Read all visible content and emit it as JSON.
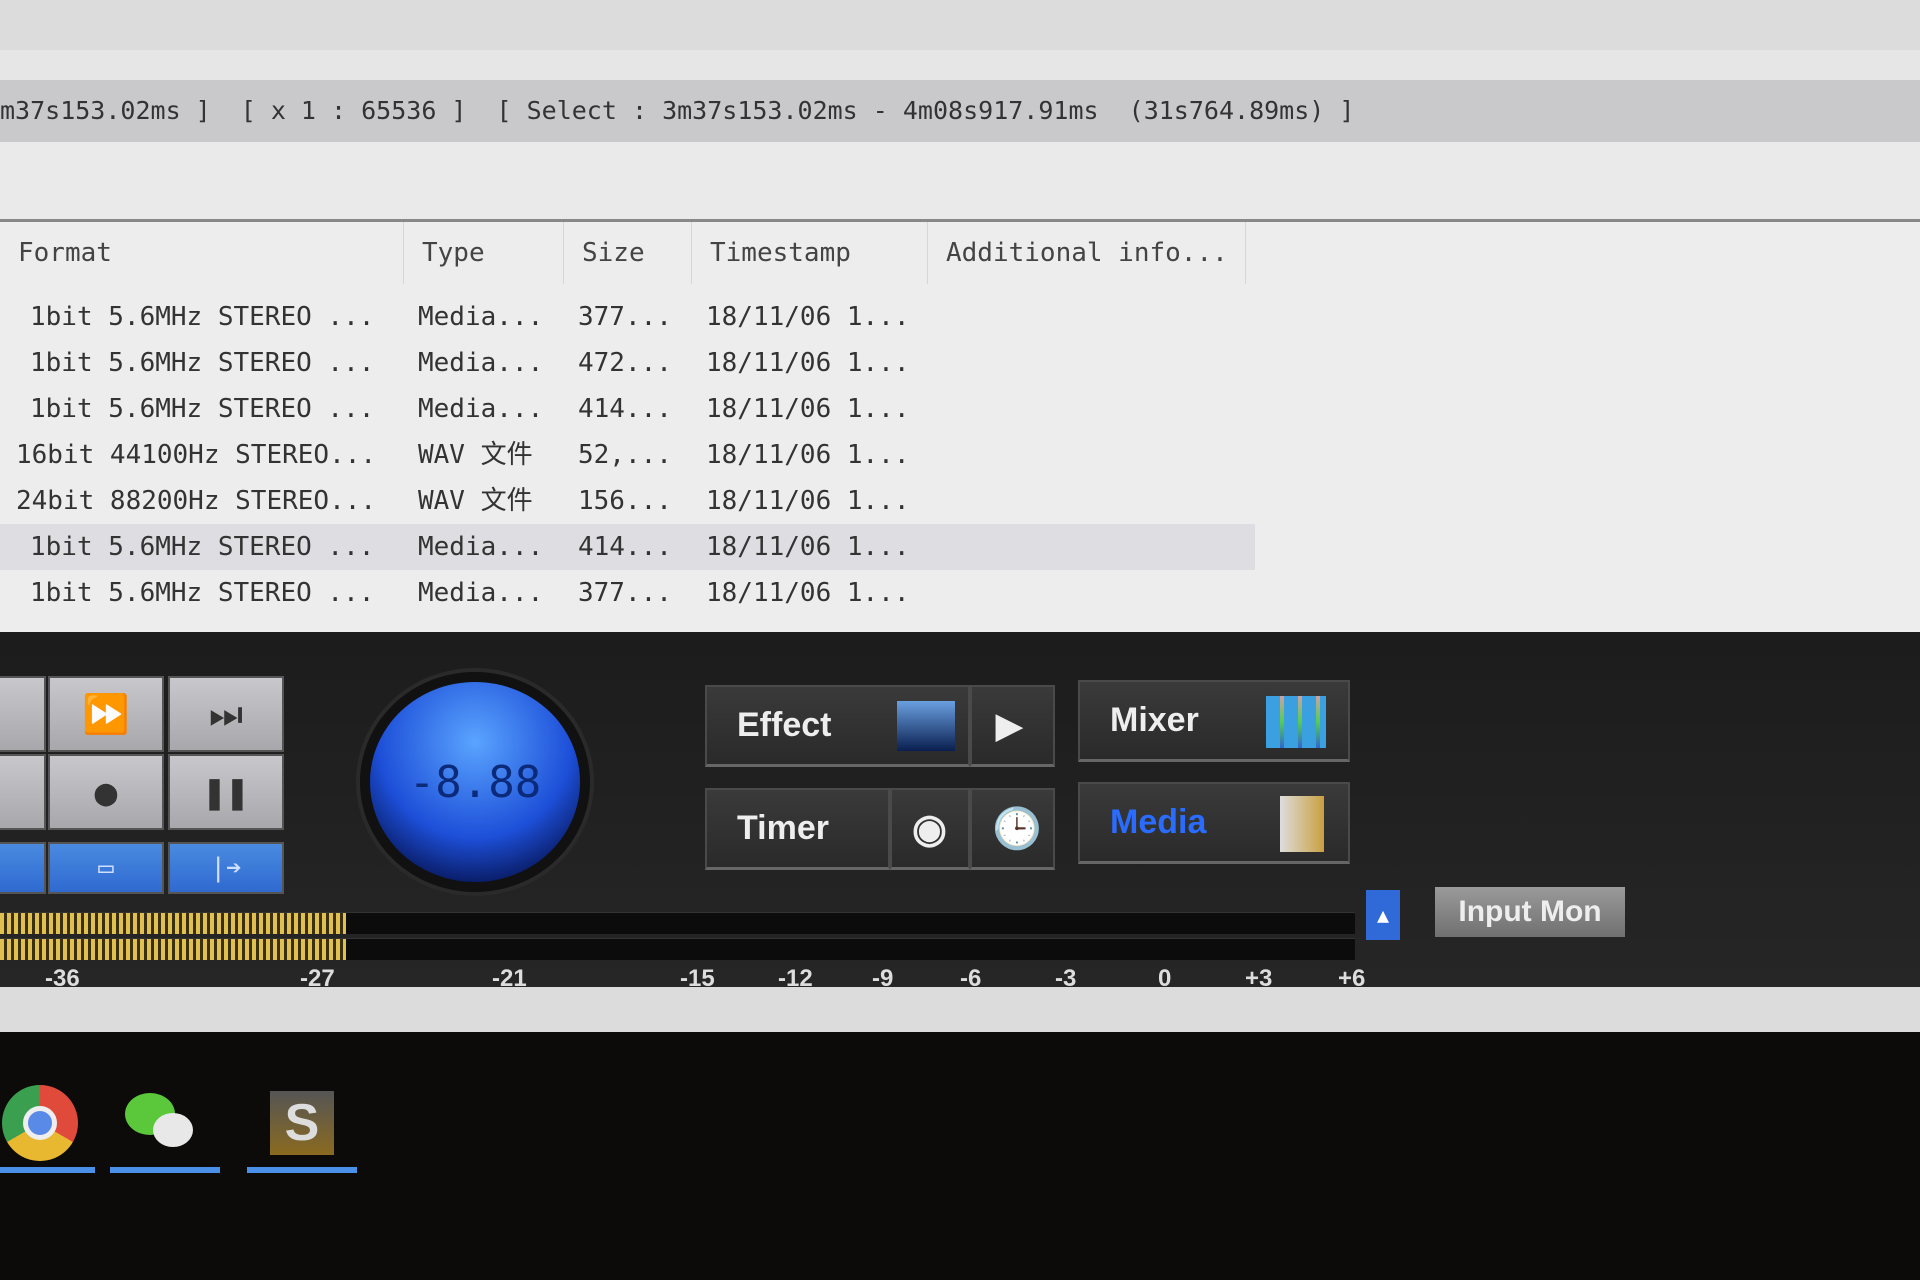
{
  "status_bar": {
    "position": "m37s153.02ms ]",
    "zoom": "[ x 1 : 65536 ]",
    "select": "[ Select : 3m37s153.02ms - 4m08s917.91ms  (31s764.89ms) ]"
  },
  "table": {
    "columns": [
      "Format",
      "Type",
      "Size",
      "Timestamp",
      "Additional info..."
    ],
    "rows": [
      [
        "1bit 5.6MHz STEREO ...",
        "Media...",
        "377...",
        "18/11/06 1..."
      ],
      [
        "1bit 5.6MHz STEREO ...",
        "Media...",
        "472...",
        "18/11/06 1..."
      ],
      [
        "1bit 5.6MHz STEREO ...",
        "Media...",
        "414...",
        "18/11/06 1..."
      ],
      [
        "16bit 44100Hz STEREO...",
        "WAV 文件",
        "52,...",
        "18/11/06 1..."
      ],
      [
        "24bit 88200Hz STEREO...",
        "WAV 文件",
        "156...",
        "18/11/06 1..."
      ],
      [
        "1bit 5.6MHz STEREO ...",
        "Media...",
        "414...",
        "18/11/06 1..."
      ],
      [
        "1bit 5.6MHz STEREO ...",
        "Media...",
        "377...",
        "18/11/06 1..."
      ]
    ],
    "selected_row": 5
  },
  "dial": {
    "value": "-8.88"
  },
  "buttons": {
    "effect": "Effect",
    "mixer": "Mixer",
    "timer": "Timer",
    "media": "Media",
    "input_mon": "Input Mon"
  },
  "meter": {
    "level_db": -27,
    "scale": [
      "-36",
      "-27",
      "-21",
      "-15",
      "-12",
      "-9",
      "-6",
      "-3",
      "0",
      "+3",
      "+6"
    ]
  },
  "taskbar": {
    "apps": [
      "chrome-icon",
      "wechat-icon",
      "app-s-icon"
    ]
  },
  "colors": {
    "accent": "#2f6ad8",
    "meter": "#e0c050",
    "media_text": "#2a6cff"
  }
}
